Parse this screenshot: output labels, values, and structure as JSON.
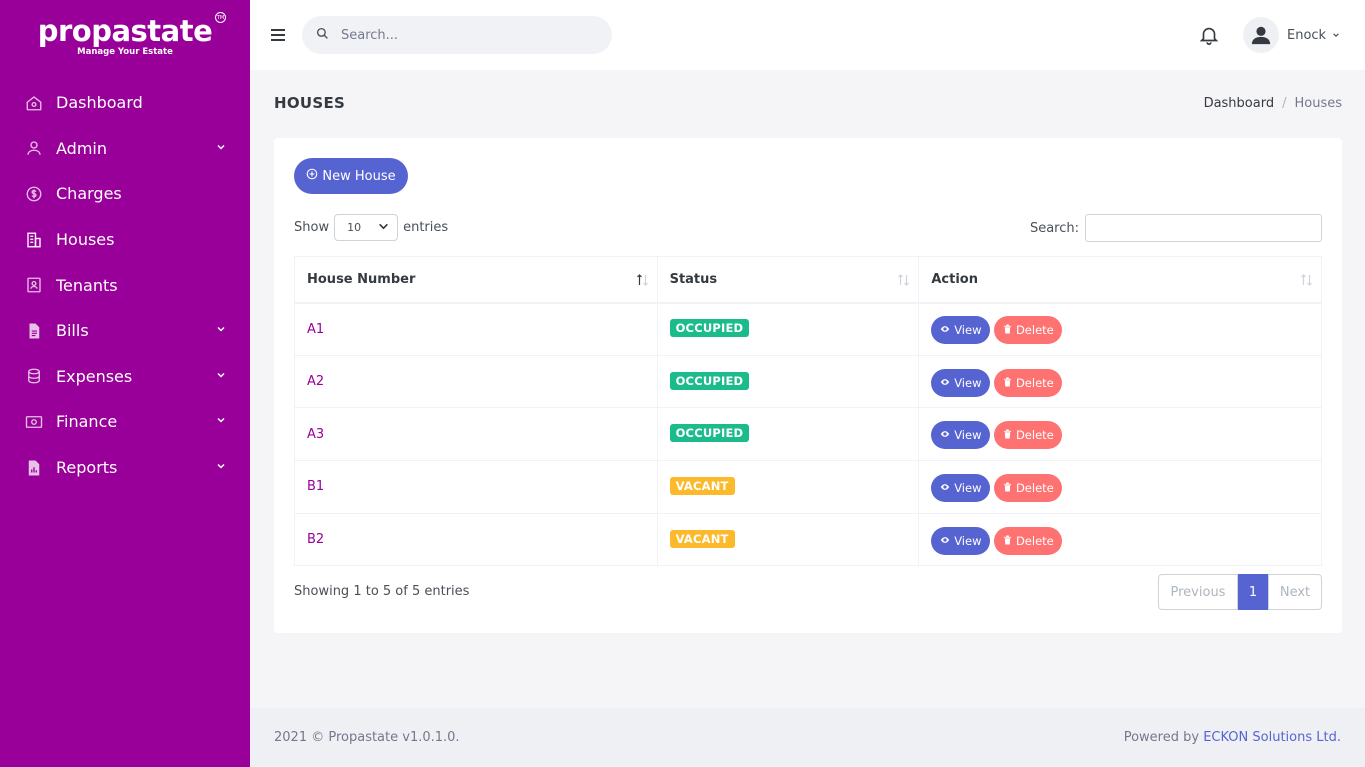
{
  "brand": {
    "name": "propastate",
    "tm": "TM",
    "tagline": "Manage Your Estate"
  },
  "sidebar": {
    "items": [
      {
        "label": "Dashboard",
        "icon": "home-icon",
        "has_submenu": false
      },
      {
        "label": "Admin",
        "icon": "user-icon",
        "has_submenu": true
      },
      {
        "label": "Charges",
        "icon": "dollar-circle-icon",
        "has_submenu": false
      },
      {
        "label": "Houses",
        "icon": "building-icon",
        "has_submenu": false
      },
      {
        "label": "Tenants",
        "icon": "contact-card-icon",
        "has_submenu": false
      },
      {
        "label": "Bills",
        "icon": "file-icon",
        "has_submenu": true
      },
      {
        "label": "Expenses",
        "icon": "database-icon",
        "has_submenu": true
      },
      {
        "label": "Finance",
        "icon": "money-icon",
        "has_submenu": true
      },
      {
        "label": "Reports",
        "icon": "report-icon",
        "has_submenu": true
      }
    ]
  },
  "topbar": {
    "search_placeholder": "Search...",
    "user_name": "Enock"
  },
  "page": {
    "title": "HOUSES",
    "breadcrumb": [
      "Dashboard",
      "Houses"
    ]
  },
  "card": {
    "new_button": "New House",
    "length": {
      "show": "Show",
      "value": "10",
      "entries": "entries"
    },
    "filter_label": "Search:",
    "columns": [
      "House Number",
      "Status",
      "Action"
    ],
    "rows": [
      {
        "house": "A1",
        "status": "OCCUPIED",
        "status_type": "occupied"
      },
      {
        "house": "A2",
        "status": "OCCUPIED",
        "status_type": "occupied"
      },
      {
        "house": "A3",
        "status": "OCCUPIED",
        "status_type": "occupied"
      },
      {
        "house": "B1",
        "status": "VACANT",
        "status_type": "vacant"
      },
      {
        "house": "B2",
        "status": "VACANT",
        "status_type": "vacant"
      }
    ],
    "view_label": "View",
    "delete_label": "Delete",
    "info": "Showing 1 to 5 of 5 entries",
    "pager": {
      "previous": "Previous",
      "current": "1",
      "next": "Next"
    }
  },
  "footer": {
    "left": "2021 © Propastate v1.0.1.0.",
    "powered": "Powered by",
    "company": "ECKON Solutions Ltd."
  },
  "colors": {
    "sidebar": "#990099",
    "primary": "#5664d2",
    "success": "#1cbb8c",
    "warning": "#fcb92c",
    "danger": "#ff6b6b"
  }
}
